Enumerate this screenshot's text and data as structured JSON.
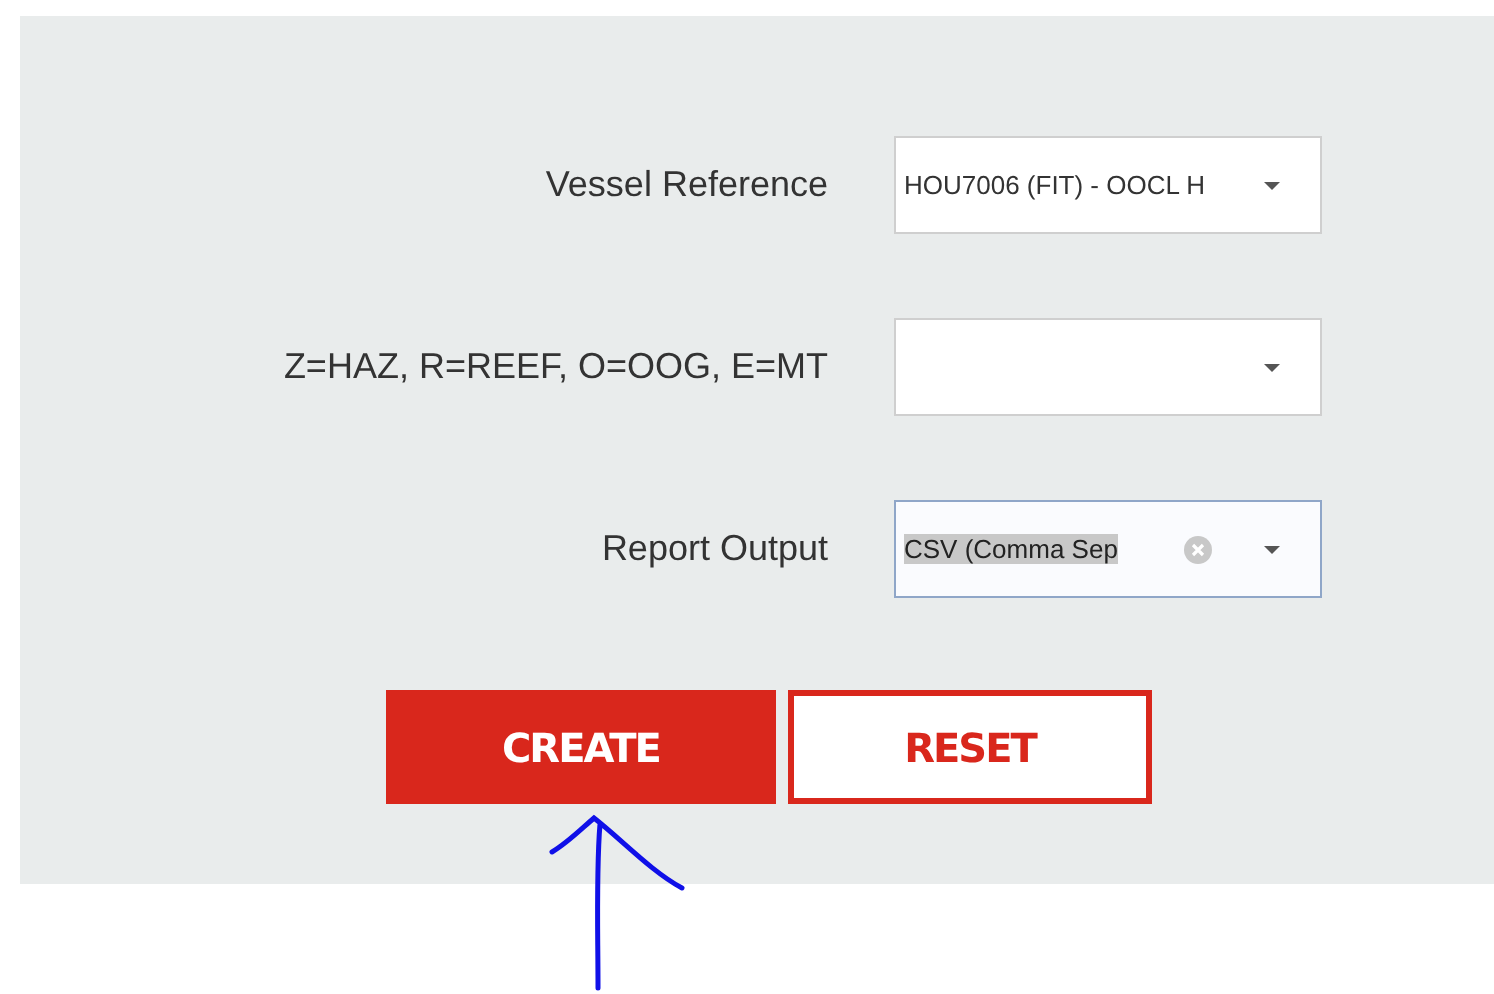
{
  "fields": [
    {
      "label": "Vessel Reference",
      "value": "HOU7006 (FIT) - OOCL H",
      "focused": false,
      "clearable": false,
      "text_selected": false
    },
    {
      "label": "Z=HAZ, R=REEF, O=OOG, E=MT",
      "focused": false,
      "clearable": false
    },
    {
      "label": "Report Output",
      "value": "CSV (Comma Sep",
      "focused": true,
      "clearable": true,
      "text_selected": true
    }
  ],
  "buttons": [
    {
      "label": "CREATE",
      "kind": "primary"
    },
    {
      "label": "RESET",
      "kind": "outline"
    }
  ]
}
